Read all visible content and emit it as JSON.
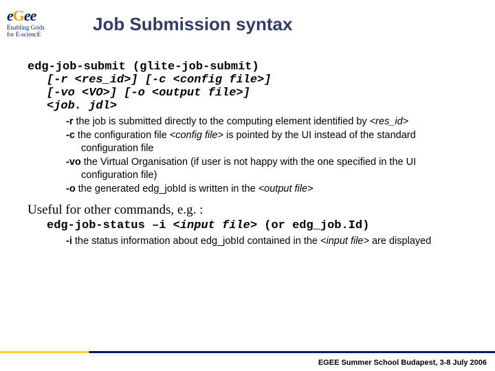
{
  "logo": {
    "main": "eGee",
    "tag1": "Enabling Grids",
    "tag2": "for E-sciencE"
  },
  "title": "Job Submission syntax",
  "cmd": "edg-job-submit (glite-job-submit)",
  "opt1": "[-r <res_id>] [-c <config file>]",
  "opt2": "[-vo <VO>] [-o <output file>]",
  "jdl": "<job. jdl>",
  "desc": {
    "r": {
      "flag": "-r",
      "text": " the job is submitted directly to the computing element identified by ",
      "ital": "<res_id>"
    },
    "c": {
      "flag": "-c",
      "text": " the configuration file ",
      "ital": "<config file>",
      "text2": " is pointed by the UI instead of the standard configuration file"
    },
    "vo": {
      "flag": "-vo",
      "text": " the Virtual Organisation (if user is not happy with the one specified in the UI configuration file)"
    },
    "o": {
      "flag": "-o",
      "text": " the generated edg_jobId is written in the ",
      "ital": "<output file>"
    }
  },
  "useful": "Useful for other commands, e.g. :",
  "cmd2": {
    "a": "edg-job-status –i ",
    "b": "<input file>",
    "c": " (or edg_job.Id)"
  },
  "desc_i": {
    "flag": "-i",
    "text": " the status information about edg_jobId contained in the ",
    "ital": "<input file>",
    "text2": " are displayed"
  },
  "footer": "EGEE Summer School Budapest, 3-8 July 2006"
}
